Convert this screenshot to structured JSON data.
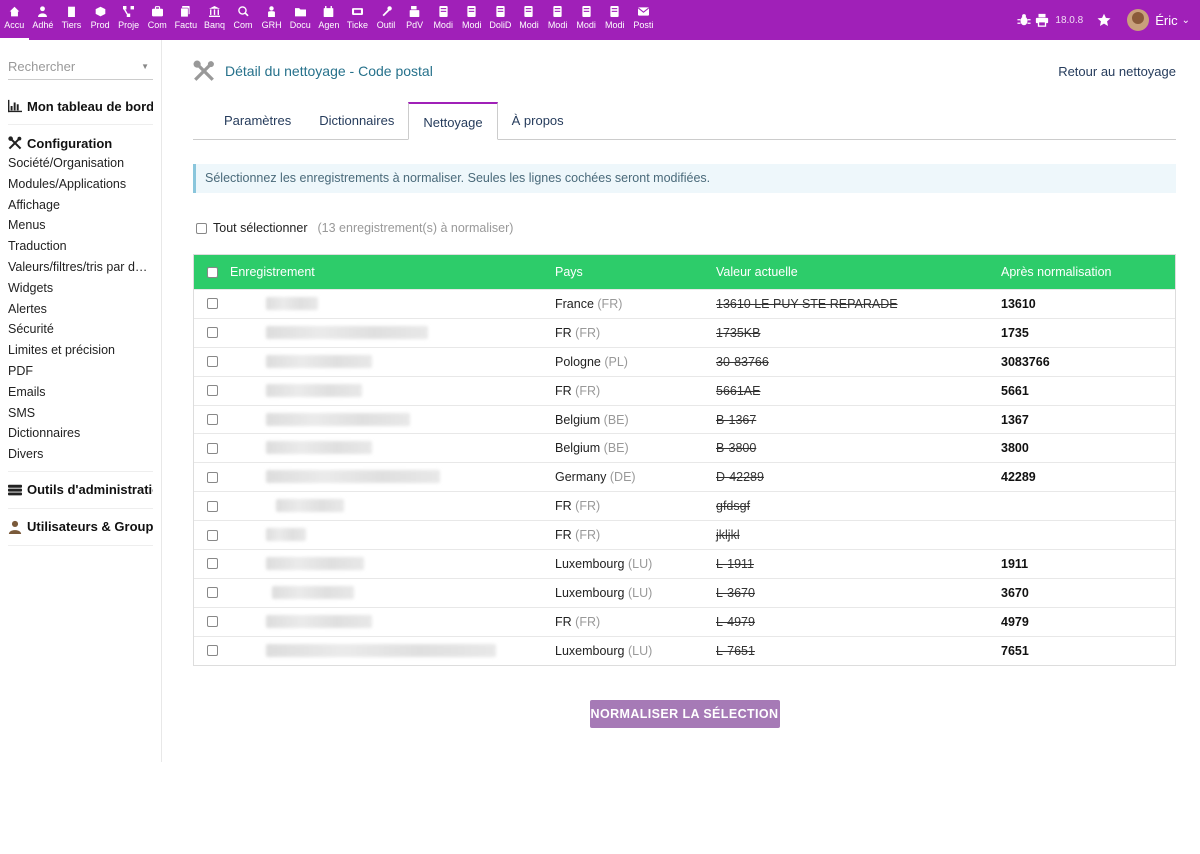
{
  "topnav": [
    {
      "label": "Accu",
      "icon": "home-icon"
    },
    {
      "label": "Adhé",
      "icon": "member-icon"
    },
    {
      "label": "Tiers",
      "icon": "building-icon"
    },
    {
      "label": "Prod",
      "icon": "cube-icon"
    },
    {
      "label": "Proje",
      "icon": "project-icon"
    },
    {
      "label": "Com",
      "icon": "briefcase-icon"
    },
    {
      "label": "Factu",
      "icon": "invoice-icon"
    },
    {
      "label": "Banq",
      "icon": "bank-icon"
    },
    {
      "label": "Com",
      "icon": "search-dollar-icon"
    },
    {
      "label": "GRH",
      "icon": "person-icon"
    },
    {
      "label": "Docu",
      "icon": "folder-icon"
    },
    {
      "label": "Agen",
      "icon": "calendar-icon"
    },
    {
      "label": "Ticke",
      "icon": "ticket-icon"
    },
    {
      "label": "Outil",
      "icon": "wrench-icon"
    },
    {
      "label": "PdV",
      "icon": "cash-register-icon"
    },
    {
      "label": "Modi",
      "icon": "module-icon"
    },
    {
      "label": "Modi",
      "icon": "module-icon"
    },
    {
      "label": "DoliD",
      "icon": "module-icon"
    },
    {
      "label": "Modi",
      "icon": "module-icon"
    },
    {
      "label": "Modi",
      "icon": "module-icon"
    },
    {
      "label": "Modi",
      "icon": "module-icon"
    },
    {
      "label": "Modi",
      "icon": "module-icon"
    },
    {
      "label": "Posti",
      "icon": "mail-icon"
    }
  ],
  "topright": {
    "version": "18.0.8",
    "username": "Éric"
  },
  "sidebar": {
    "search_placeholder": "Rechercher",
    "dashboard": "Mon tableau de bord",
    "config": "Configuration",
    "config_items": [
      "Société/Organisation",
      "Modules/Applications",
      "Affichage",
      "Menus",
      "Traduction",
      "Valeurs/filtres/tris par défaut",
      "Widgets",
      "Alertes",
      "Sécurité",
      "Limites et précision",
      "PDF",
      "Emails",
      "SMS",
      "Dictionnaires",
      "Divers"
    ],
    "admin_tools": "Outils d'administration",
    "users_groups": "Utilisateurs & Groupes"
  },
  "main": {
    "title": "Détail du nettoyage - Code postal",
    "back_link": "Retour au nettoyage",
    "tabs": [
      "Paramètres",
      "Dictionnaires",
      "Nettoyage",
      "À propos"
    ],
    "info": "Sélectionnez les enregistrements à normaliser. Seules les lignes cochées seront modifiées.",
    "select_all": "Tout sélectionner",
    "count_note": "(13 enregistrement(s) à normaliser)",
    "headers": {
      "record": "Enregistrement",
      "country": "Pays",
      "current": "Valeur actuelle",
      "after": "Après normalisation"
    },
    "rows": [
      {
        "country": "France",
        "code": "(FR)",
        "current": "13610 LE PUY STE REPARADE",
        "after": "13610"
      },
      {
        "country": "FR",
        "code": "(FR)",
        "current": "1735KB",
        "after": "1735"
      },
      {
        "country": "Pologne",
        "code": "(PL)",
        "current": "30-83766",
        "after": "3083766"
      },
      {
        "country": "FR",
        "code": "(FR)",
        "current": "5661AE",
        "after": "5661"
      },
      {
        "country": "Belgium",
        "code": "(BE)",
        "current": "B-1367",
        "after": "1367"
      },
      {
        "country": "Belgium",
        "code": "(BE)",
        "current": "B-3800",
        "after": "3800"
      },
      {
        "country": "Germany",
        "code": "(DE)",
        "current": "D-42289",
        "after": "42289"
      },
      {
        "country": "FR",
        "code": "(FR)",
        "current": "gfdsgf",
        "after": ""
      },
      {
        "country": "FR",
        "code": "(FR)",
        "current": "jkljkl",
        "after": ""
      },
      {
        "country": "Luxembourg",
        "code": "(LU)",
        "current": "L-1911",
        "after": "1911"
      },
      {
        "country": "Luxembourg",
        "code": "(LU)",
        "current": "L-3670",
        "after": "3670"
      },
      {
        "country": "FR",
        "code": "(FR)",
        "current": "L-4979",
        "after": "4979"
      },
      {
        "country": "Luxembourg",
        "code": "(LU)",
        "current": "L-7651",
        "after": "7651"
      }
    ],
    "submit": "NORMALISER LA SÉLECTION"
  }
}
